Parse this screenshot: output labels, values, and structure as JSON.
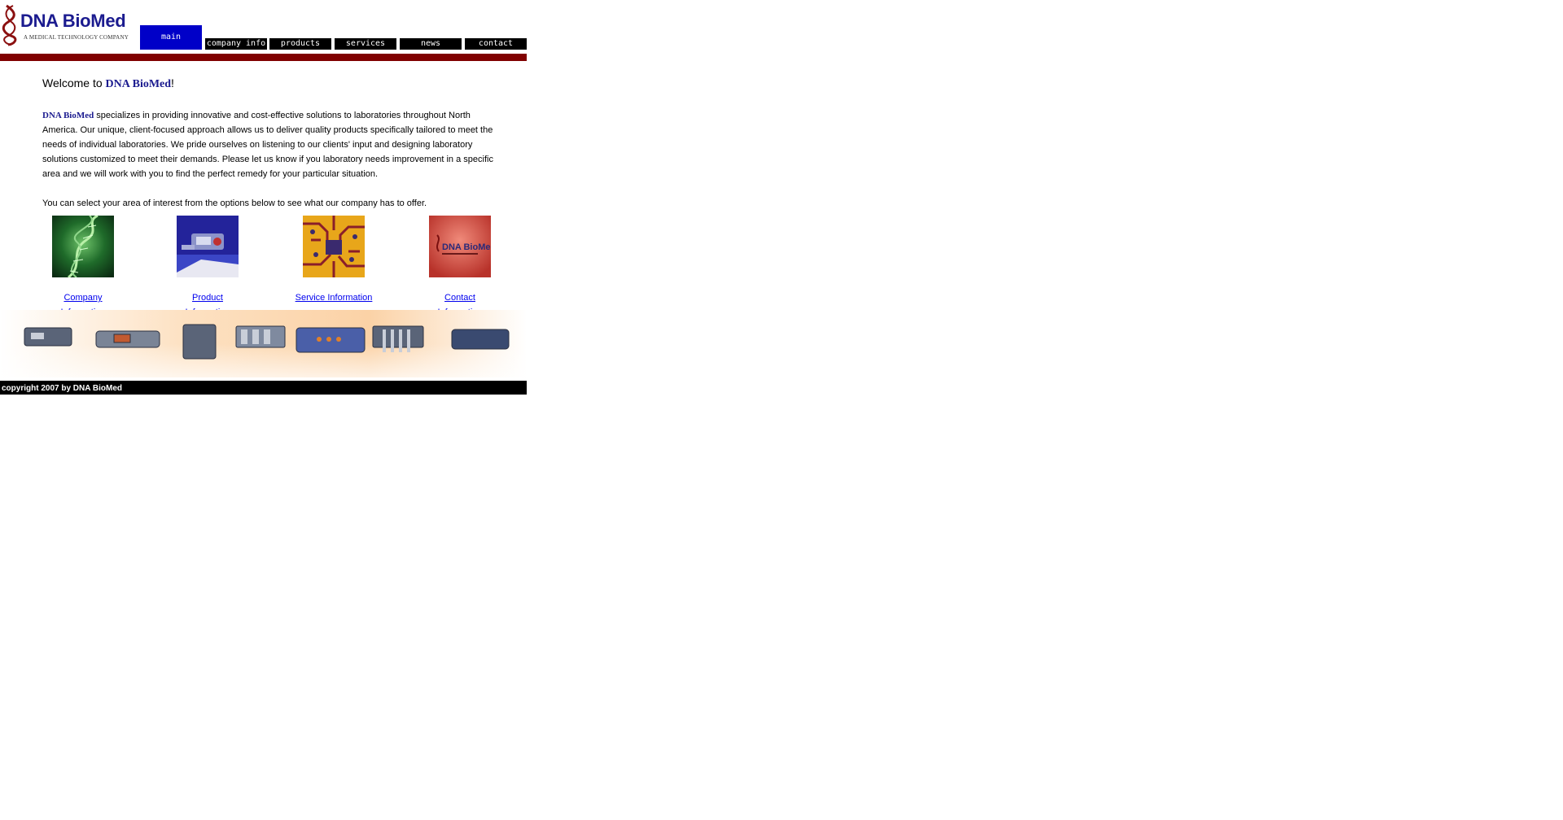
{
  "logo": {
    "brand": "DNA BioMed",
    "tagline": "A MEDICAL TECHNOLOGY COMPANY"
  },
  "nav": {
    "main": "main",
    "items": [
      "company info",
      "products",
      "services",
      "news",
      "contact"
    ]
  },
  "content": {
    "welcome_prefix": "Welcome to ",
    "welcome_brand": "DNA BioMed",
    "welcome_suffix": "!",
    "intro_brand": "DNA BioMed",
    "intro_text": " specializes in providing innovative and cost-effective solutions to laboratories throughout North America. Our unique, client-focused approach allows us to deliver quality products specifically tailored to meet the needs of individual laboratories. We pride ourselves on listening to our clients' input and designing laboratory solutions customized to meet their demands. Please let us know if you laboratory needs improvement in a specific area and we will work with you to find the perfect remedy for your particular situation.",
    "select_text": "You can select your area of interest from the options below to see what our company has to offer."
  },
  "sections": [
    {
      "line1": "Company",
      "line2": "Information"
    },
    {
      "line1": "Product",
      "line2": "Information"
    },
    {
      "line1": "Service Information",
      "line2": ""
    },
    {
      "line1": "Contact",
      "line2": "Information"
    }
  ],
  "sign_text": "DNA BioMed",
  "footer": {
    "copyright": "copyright 2007 by DNA BioMed"
  },
  "colors": {
    "nav_active": "#0000c8",
    "nav_inactive": "#000000",
    "accent_bar": "#800000",
    "brand_text": "#1b1b8f",
    "link": "#0000ee"
  }
}
